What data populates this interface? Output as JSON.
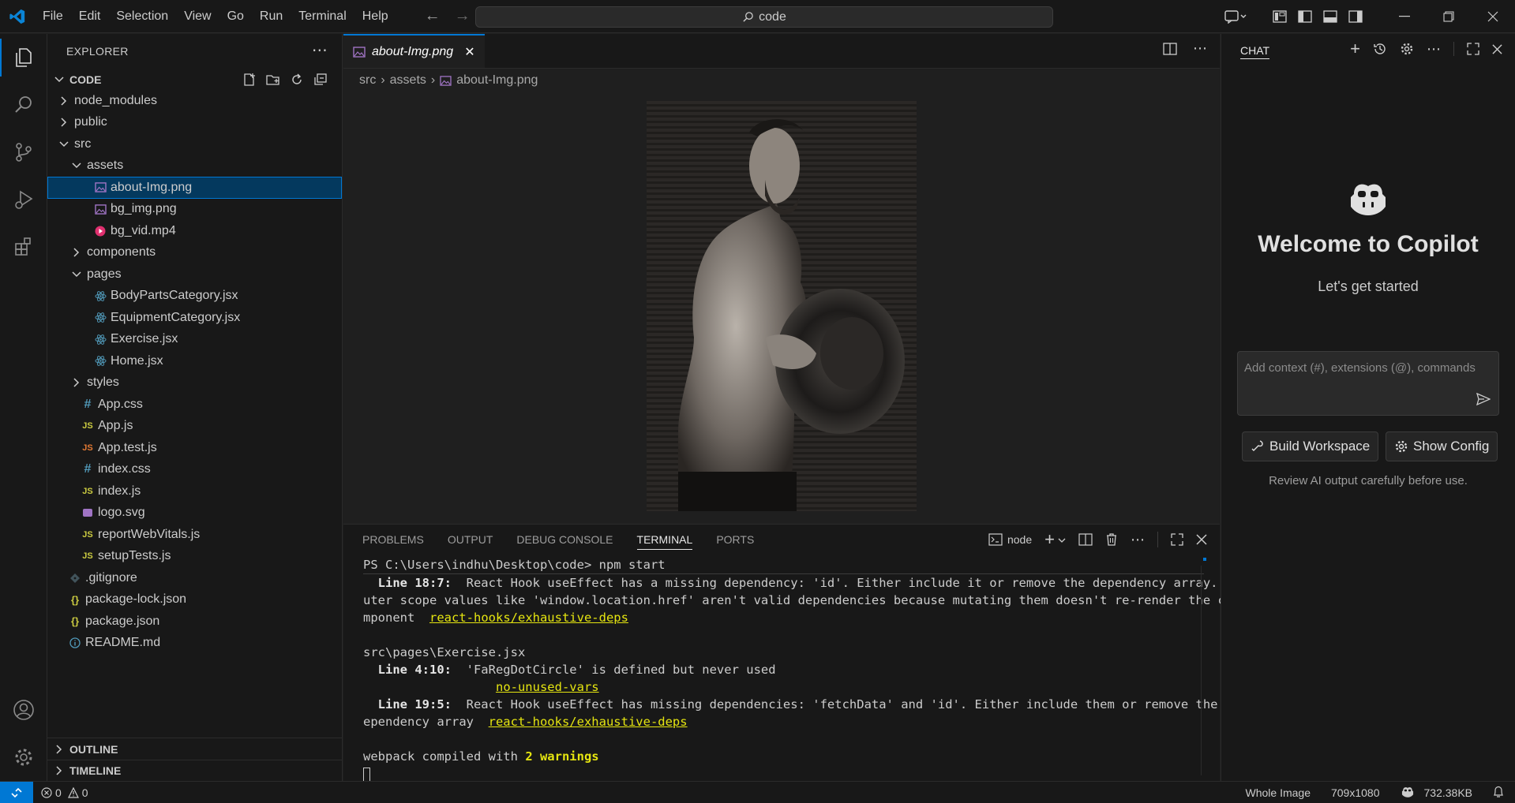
{
  "menu": [
    "File",
    "Edit",
    "Selection",
    "View",
    "Go",
    "Run",
    "Terminal",
    "Help"
  ],
  "command_center": "code",
  "sidebar": {
    "title": "EXPLORER",
    "section": "CODE",
    "tree": [
      {
        "label": "node_modules",
        "type": "folder",
        "open": false,
        "indent": 0
      },
      {
        "label": "public",
        "type": "folder",
        "open": false,
        "indent": 0
      },
      {
        "label": "src",
        "type": "folder",
        "open": true,
        "indent": 0
      },
      {
        "label": "assets",
        "type": "folder",
        "open": true,
        "indent": 1
      },
      {
        "label": "about-Img.png",
        "type": "image",
        "indent": 2,
        "selected": true
      },
      {
        "label": "bg_img.png",
        "type": "image",
        "indent": 2
      },
      {
        "label": "bg_vid.mp4",
        "type": "video",
        "indent": 2
      },
      {
        "label": "components",
        "type": "folder",
        "open": false,
        "indent": 1
      },
      {
        "label": "pages",
        "type": "folder",
        "open": true,
        "indent": 1
      },
      {
        "label": "BodyPartsCategory.jsx",
        "type": "react",
        "indent": 2
      },
      {
        "label": "EquipmentCategory.jsx",
        "type": "react",
        "indent": 2
      },
      {
        "label": "Exercise.jsx",
        "type": "react",
        "indent": 2
      },
      {
        "label": "Home.jsx",
        "type": "react",
        "indent": 2
      },
      {
        "label": "styles",
        "type": "folder",
        "open": false,
        "indent": 1
      },
      {
        "label": "App.css",
        "type": "css",
        "indent": 1
      },
      {
        "label": "App.js",
        "type": "js",
        "indent": 1
      },
      {
        "label": "App.test.js",
        "type": "jstest",
        "indent": 1
      },
      {
        "label": "index.css",
        "type": "css",
        "indent": 1
      },
      {
        "label": "index.js",
        "type": "js",
        "indent": 1
      },
      {
        "label": "logo.svg",
        "type": "svg",
        "indent": 1
      },
      {
        "label": "reportWebVitals.js",
        "type": "js",
        "indent": 1
      },
      {
        "label": "setupTests.js",
        "type": "js",
        "indent": 1
      },
      {
        "label": ".gitignore",
        "type": "git",
        "indent": 0
      },
      {
        "label": "package-lock.json",
        "type": "json",
        "indent": 0
      },
      {
        "label": "package.json",
        "type": "json",
        "indent": 0
      },
      {
        "label": "README.md",
        "type": "info",
        "indent": 0
      }
    ],
    "outline": "OUTLINE",
    "timeline": "TIMELINE"
  },
  "editor": {
    "tab_label": "about-Img.png",
    "breadcrumbs": [
      "src",
      "assets",
      "about-Img.png"
    ]
  },
  "panel": {
    "tabs": [
      "PROBLEMS",
      "OUTPUT",
      "DEBUG CONSOLE",
      "TERMINAL",
      "PORTS"
    ],
    "active_tab": "TERMINAL",
    "shell": "node",
    "terminal": {
      "prompt": "PS C:\\Users\\indhu\\Desktop\\code> ",
      "command": "npm start",
      "l1_loc": "  Line 18:7:",
      "l1_msg": "  React Hook useEffect has a missing dependency: 'id'. Either include it or remove the dependency array. O",
      "l2": "uter scope values like 'window.location.href' aren't valid dependencies because mutating them doesn't re-render the co",
      "l3": "mponent  ",
      "l3_rule": "react-hooks/exhaustive-deps",
      "file": "src\\pages\\Exercise.jsx",
      "l5_loc": "  Line 4:10:",
      "l5_msg": "  'FaRegDotCircle' is defined but never used",
      "l6_pad": "                  ",
      "l6_rule": "no-unused-vars",
      "l7_loc": "  Line 19:5:",
      "l7_msg": "  React Hook useEffect has missing dependencies: 'fetchData' and 'id'. Either include them or remove the d",
      "l8": "ependency array  ",
      "l8_rule": "react-hooks/exhaustive-deps",
      "compiled": "webpack compiled with ",
      "warnings": "2 warnings"
    }
  },
  "chat": {
    "title": "CHAT",
    "welcome": "Welcome to Copilot",
    "subtitle": "Let's get started",
    "input_placeholder": "Add context (#), extensions (@), commands",
    "build_btn": "Build Workspace",
    "config_btn": "Show Config",
    "note": "Review AI output carefully before use."
  },
  "status": {
    "errors": "0",
    "warnings": "0",
    "view_mode": "Whole Image",
    "dimensions": "709x1080",
    "size": "732.38KB"
  },
  "colors": {
    "accent": "#0078d4",
    "background": "#1f1f1f",
    "sidebar_bg": "#181818",
    "selection": "#04395e",
    "terminal_yellow": "#e5e510"
  }
}
